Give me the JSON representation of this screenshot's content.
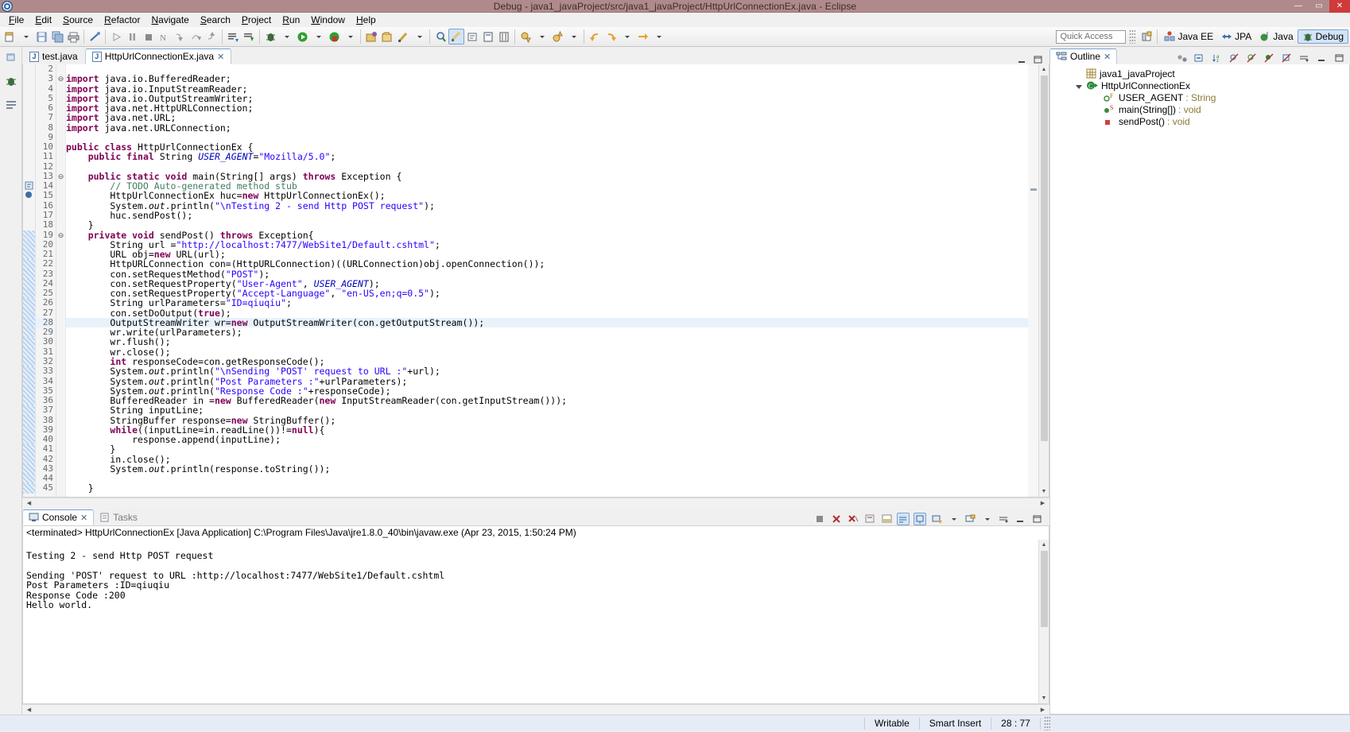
{
  "window": {
    "title": "Debug - java1_javaProject/src/java1_javaProject/HttpUrlConnectionEx.java - Eclipse",
    "minimize": "—",
    "maximize": "▭",
    "close": "✕",
    "logo_icon": "eclipse-logo-icon"
  },
  "menu": [
    "File",
    "Edit",
    "Source",
    "Refactor",
    "Navigate",
    "Search",
    "Project",
    "Run",
    "Window",
    "Help"
  ],
  "toolbar": {
    "quick_access_placeholder": "Quick Access",
    "icons": [
      "new-wizard-icon",
      "save-icon",
      "save-all-icon",
      "print-icon",
      "link-icon",
      "resume-icon",
      "suspend-icon",
      "terminate-icon",
      "disconnect-icon",
      "step-into-icon",
      "step-over-icon",
      "step-return-icon",
      "open-task-icon",
      "new-task-icon",
      "debug-icon",
      "run-icon",
      "run-coverage-icon",
      "new-package-icon",
      "open-type-icon",
      "external-tools-icon",
      "search-icon",
      "marker-icon",
      "toggle-annotation-icon",
      "toggle-block-icon",
      "toggle-whitespace-icon",
      "next-annotation-icon",
      "previous-annotation-icon",
      "back-icon",
      "forward-icon",
      "next-edit-icon"
    ],
    "perspectives": [
      {
        "label": "Java EE",
        "icon": "java-ee-perspective-icon",
        "active": false
      },
      {
        "label": "JPA",
        "icon": "jpa-perspective-icon",
        "active": false
      },
      {
        "label": "Java",
        "icon": "java-perspective-icon",
        "active": false
      },
      {
        "label": "Debug",
        "icon": "debug-perspective-icon",
        "active": true
      }
    ],
    "open_perspective_icon": "open-perspective-icon"
  },
  "editor": {
    "tabs": [
      {
        "label": "test.java",
        "active": false,
        "icon": "java-file-icon"
      },
      {
        "label": "HttpUrlConnectionEx.java",
        "active": true,
        "icon": "java-file-icon",
        "close": "✕"
      }
    ],
    "minimize_icon": "minimize-icon",
    "maximize_icon": "maximize-icon",
    "highlight_line": 28,
    "first_line": 2,
    "lines": [
      {
        "n": 2,
        "fold": "",
        "mark": "",
        "html": ""
      },
      {
        "n": 3,
        "fold": "⊖",
        "mark": "",
        "html": "<span class='kw'>import</span> java.io.BufferedReader;"
      },
      {
        "n": 4,
        "fold": "",
        "mark": "",
        "html": "<span class='kw'>import</span> java.io.InputStreamReader;"
      },
      {
        "n": 5,
        "fold": "",
        "mark": "",
        "html": "<span class='kw'>import</span> java.io.OutputStreamWriter;"
      },
      {
        "n": 6,
        "fold": "",
        "mark": "",
        "html": "<span class='kw'>import</span> java.net.HttpURLConnection;"
      },
      {
        "n": 7,
        "fold": "",
        "mark": "",
        "html": "<span class='kw'>import</span> java.net.URL;"
      },
      {
        "n": 8,
        "fold": "",
        "mark": "",
        "html": "<span class='kw'>import</span> java.net.URLConnection;"
      },
      {
        "n": 9,
        "fold": "",
        "mark": "",
        "html": ""
      },
      {
        "n": 10,
        "fold": "",
        "mark": "",
        "html": "<span class='kw'>public class</span> HttpUrlConnectionEx {"
      },
      {
        "n": 11,
        "fold": "",
        "mark": "",
        "html": "    <span class='kw'>public final</span> String <span class='fld'>USER_AGENT</span>=<span class='str'>\"Mozilla/5.0\"</span>;"
      },
      {
        "n": 12,
        "fold": "",
        "mark": "",
        "html": ""
      },
      {
        "n": 13,
        "fold": "⊖",
        "mark": "",
        "html": "    <span class='kw'>public static void</span> main(String[] args) <span class='kw'>throws</span> Exception {"
      },
      {
        "n": 14,
        "fold": "",
        "mark": "todo-icon",
        "html": "        <span class='cmt'>// TODO Auto-generated method stub</span>"
      },
      {
        "n": 15,
        "fold": "",
        "mark": "breakpoint-icon",
        "html": "        HttpUrlConnectionEx huc=<span class='kw'>new</span> HttpUrlConnectionEx();"
      },
      {
        "n": 16,
        "fold": "",
        "mark": "",
        "html": "        System.<span class='stc'>out</span>.println(<span class='str'>\"\\nTesting 2 - send Http POST request\"</span>);"
      },
      {
        "n": 17,
        "fold": "",
        "mark": "",
        "html": "        huc.sendPost();"
      },
      {
        "n": 18,
        "fold": "",
        "mark": "",
        "html": "    }"
      },
      {
        "n": 19,
        "fold": "⊖",
        "mark": "changed",
        "html": "    <span class='kw'>private void</span> sendPost() <span class='kw'>throws</span> Exception{"
      },
      {
        "n": 20,
        "fold": "",
        "mark": "changed",
        "html": "        String url =<span class='str'>\"http://localhost:7477/WebSite1/Default.cshtml\"</span>;"
      },
      {
        "n": 21,
        "fold": "",
        "mark": "changed",
        "html": "        URL obj=<span class='kw'>new</span> URL(url);"
      },
      {
        "n": 22,
        "fold": "",
        "mark": "changed",
        "html": "        HttpURLConnection con=(HttpURLConnection)((URLConnection)obj.openConnection());"
      },
      {
        "n": 23,
        "fold": "",
        "mark": "changed",
        "html": "        con.setRequestMethod(<span class='str'>\"POST\"</span>);"
      },
      {
        "n": 24,
        "fold": "",
        "mark": "changed",
        "html": "        con.setRequestProperty(<span class='str'>\"User-Agent\"</span>, <span class='fld'>USER_AGENT</span>);"
      },
      {
        "n": 25,
        "fold": "",
        "mark": "changed",
        "html": "        con.setRequestProperty(<span class='str'>\"Accept-Language\"</span>, <span class='str'>\"en-US,en;q=0.5\"</span>);"
      },
      {
        "n": 26,
        "fold": "",
        "mark": "changed",
        "html": "        String urlParameters=<span class='str'>\"ID=qiuqiu\"</span>;"
      },
      {
        "n": 27,
        "fold": "",
        "mark": "changed",
        "html": "        con.setDoOutput(<span class='kw'>true</span>);"
      },
      {
        "n": 28,
        "fold": "",
        "mark": "changed",
        "html": "        OutputStreamWriter wr=<span class='kw'>new</span> OutputStreamWriter(con.getOutputStream());"
      },
      {
        "n": 29,
        "fold": "",
        "mark": "changed",
        "html": "        wr.write(urlParameters);"
      },
      {
        "n": 30,
        "fold": "",
        "mark": "changed",
        "html": "        wr.flush();"
      },
      {
        "n": 31,
        "fold": "",
        "mark": "changed",
        "html": "        wr.close();"
      },
      {
        "n": 32,
        "fold": "",
        "mark": "changed",
        "html": "        <span class='kw'>int</span> responseCode=con.getResponseCode();"
      },
      {
        "n": 33,
        "fold": "",
        "mark": "changed",
        "html": "        System.<span class='stc'>out</span>.println(<span class='str'>\"\\nSending 'POST' request to URL :\"</span>+url);"
      },
      {
        "n": 34,
        "fold": "",
        "mark": "changed",
        "html": "        System.<span class='stc'>out</span>.println(<span class='str'>\"Post Parameters :\"</span>+urlParameters);"
      },
      {
        "n": 35,
        "fold": "",
        "mark": "changed",
        "html": "        System.<span class='stc'>out</span>.println(<span class='str'>\"Response Code :\"</span>+responseCode);"
      },
      {
        "n": 36,
        "fold": "",
        "mark": "changed",
        "html": "        BufferedReader in =<span class='kw'>new</span> BufferedReader(<span class='kw'>new</span> InputStreamReader(con.getInputStream()));"
      },
      {
        "n": 37,
        "fold": "",
        "mark": "changed",
        "html": "        String inputLine;"
      },
      {
        "n": 38,
        "fold": "",
        "mark": "changed",
        "html": "        StringBuffer response=<span class='kw'>new</span> StringBuffer();"
      },
      {
        "n": 39,
        "fold": "",
        "mark": "changed",
        "html": "        <span class='kw'>while</span>((inputLine=in.readLine())!=<span class='kw'>null</span>){"
      },
      {
        "n": 40,
        "fold": "",
        "mark": "changed",
        "html": "            response.append(inputLine);"
      },
      {
        "n": 41,
        "fold": "",
        "mark": "changed",
        "html": "        }"
      },
      {
        "n": 42,
        "fold": "",
        "mark": "changed",
        "html": "        in.close();"
      },
      {
        "n": 43,
        "fold": "",
        "mark": "changed",
        "html": "        System.<span class='stc'>out</span>.println(response.toString());"
      },
      {
        "n": 44,
        "fold": "",
        "mark": "changed",
        "html": ""
      },
      {
        "n": 45,
        "fold": "",
        "mark": "changed",
        "html": "    }"
      }
    ]
  },
  "outline": {
    "tab_label": "Outline",
    "tab_close": "✕",
    "tab_icon": "outline-icon",
    "tools": [
      "focus-active-task-icon",
      "collapse-all-icon",
      "sort-icon",
      "hide-fields-icon",
      "hide-static-icon",
      "hide-non-public-icon",
      "hide-local-types-icon",
      "view-menu-icon",
      "minimize-icon",
      "maximize-icon"
    ],
    "items": [
      {
        "label": "java1_javaProject",
        "type": "",
        "icon": "package-icon",
        "indent": 1,
        "expander": ""
      },
      {
        "label": "HttpUrlConnectionEx",
        "type": "",
        "icon": "class-icon",
        "indent": 1,
        "expander": "open"
      },
      {
        "label": "USER_AGENT",
        "type": " : String",
        "icon": "field-public-icon",
        "indent": 2,
        "expander": ""
      },
      {
        "label": "main(String[])",
        "type": " : void",
        "icon": "method-static-icon",
        "indent": 2,
        "expander": ""
      },
      {
        "label": "sendPost()",
        "type": " : void",
        "icon": "method-private-icon",
        "indent": 2,
        "expander": ""
      }
    ]
  },
  "console": {
    "tabs": [
      {
        "label": "Console",
        "active": true,
        "icon": "console-icon",
        "close": "✕"
      },
      {
        "label": "Tasks",
        "active": false,
        "icon": "tasks-icon"
      }
    ],
    "tools": [
      "terminate-icon",
      "remove-launch-icon",
      "remove-all-terminated-icon",
      "clear-console-icon",
      "scroll-lock-icon",
      "word-wrap-icon",
      "pin-console-icon",
      "display-selected-console-icon",
      "open-console-icon",
      "view-menu-icon",
      "minimize-icon",
      "maximize-icon"
    ],
    "launch_info": "<terminated> HttpUrlConnectionEx [Java Application] C:\\Program Files\\Java\\jre1.8.0_40\\bin\\javaw.exe (Apr 23, 2015, 1:50:24 PM)",
    "output": "Testing 2 - send Http POST request\n\nSending 'POST' request to URL :http://localhost:7477/WebSite1/Default.cshtml\nPost Parameters :ID=qiuqiu\nResponse Code :200\nHello world."
  },
  "statusbar": {
    "writable": "Writable",
    "insert_mode": "Smart Insert",
    "position": "28 : 77"
  },
  "colors": {
    "titlebar": "#b08a8a",
    "accent_selection": "#d2e4f7",
    "keyword": "#7f0055",
    "string": "#2a00ff",
    "comment": "#3f7f5f",
    "field": "#0000c0",
    "close_button": "#cf3a3a"
  }
}
